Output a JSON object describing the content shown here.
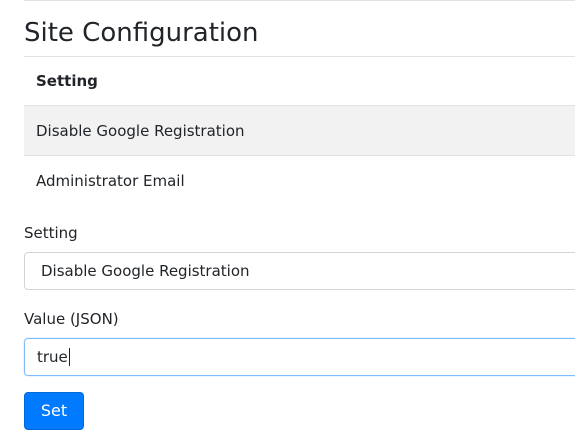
{
  "page": {
    "title": "Site Configuration"
  },
  "table": {
    "header": "Setting",
    "rows": [
      "Disable Google Registration",
      "Administrator Email"
    ]
  },
  "form": {
    "setting_label": "Setting",
    "setting_value": "Disable Google Registration",
    "value_label": "Value (JSON)",
    "value_input": "true",
    "submit_label": "Set"
  },
  "colors": {
    "primary": "#007bff",
    "striped_row": "#f2f2f2",
    "border": "#dee2e6"
  }
}
